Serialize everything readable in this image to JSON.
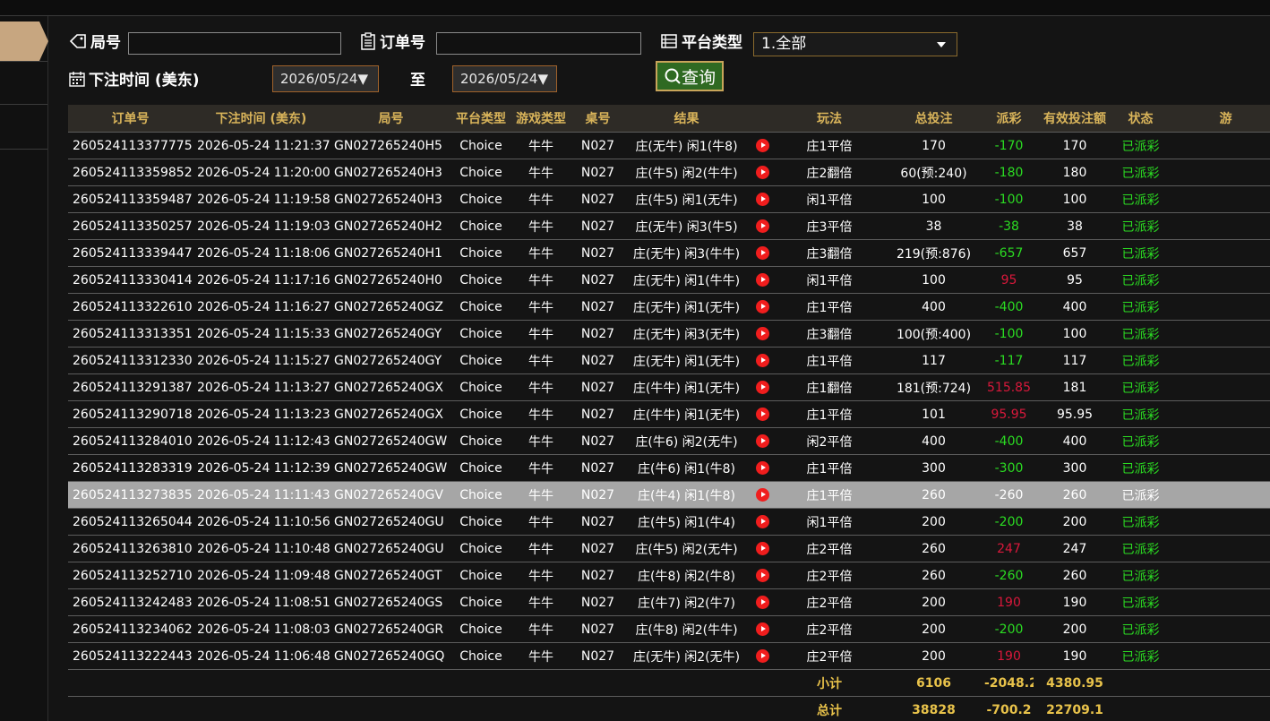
{
  "filters": {
    "round_label": "局号",
    "order_label": "订单号",
    "platform_label": "平台类型",
    "platform_value": "1.全部",
    "time_label": "下注时间 (美东)",
    "date_from": "2026/05/24▼",
    "to_label": "至",
    "date_to": "2026/05/24▼",
    "query_label": "查询"
  },
  "table": {
    "headers": [
      "订单号",
      "下注时间 (美东)",
      "局号",
      "平台类型",
      "游戏类型",
      "桌号",
      "结果",
      "",
      "玩法",
      "总投注",
      "派彩",
      "有效投注额",
      "状态",
      "游"
    ],
    "rows": [
      [
        "260524113377775",
        "2026-05-24 11:21:37",
        "GN027265240H5",
        "Choice",
        "牛牛",
        "N027",
        "庄(无牛) 闲1(牛8)",
        "庄1平倍",
        "170",
        "-170",
        "170",
        "已派彩"
      ],
      [
        "260524113359852",
        "2026-05-24 11:20:00",
        "GN027265240H3",
        "Choice",
        "牛牛",
        "N027",
        "庄(牛5) 闲2(牛牛)",
        "庄2翻倍",
        "60(预:240)",
        "-180",
        "180",
        "已派彩"
      ],
      [
        "260524113359487",
        "2026-05-24 11:19:58",
        "GN027265240H3",
        "Choice",
        "牛牛",
        "N027",
        "庄(牛5) 闲1(无牛)",
        "闲1平倍",
        "100",
        "-100",
        "100",
        "已派彩"
      ],
      [
        "260524113350257",
        "2026-05-24 11:19:03",
        "GN027265240H2",
        "Choice",
        "牛牛",
        "N027",
        "庄(无牛) 闲3(牛5)",
        "庄3平倍",
        "38",
        "-38",
        "38",
        "已派彩"
      ],
      [
        "260524113339447",
        "2026-05-24 11:18:06",
        "GN027265240H1",
        "Choice",
        "牛牛",
        "N027",
        "庄(无牛) 闲3(牛牛)",
        "庄3翻倍",
        "219(预:876)",
        "-657",
        "657",
        "已派彩"
      ],
      [
        "260524113330414",
        "2026-05-24 11:17:16",
        "GN027265240H0",
        "Choice",
        "牛牛",
        "N027",
        "庄(无牛) 闲1(牛牛)",
        "闲1平倍",
        "100",
        "95",
        "95",
        "已派彩"
      ],
      [
        "260524113322610",
        "2026-05-24 11:16:27",
        "GN027265240GZ",
        "Choice",
        "牛牛",
        "N027",
        "庄(无牛) 闲1(无牛)",
        "庄1平倍",
        "400",
        "-400",
        "400",
        "已派彩"
      ],
      [
        "260524113313351",
        "2026-05-24 11:15:33",
        "GN027265240GY",
        "Choice",
        "牛牛",
        "N027",
        "庄(无牛) 闲3(无牛)",
        "庄3翻倍",
        "100(预:400)",
        "-100",
        "100",
        "已派彩"
      ],
      [
        "260524113312330",
        "2026-05-24 11:15:27",
        "GN027265240GY",
        "Choice",
        "牛牛",
        "N027",
        "庄(无牛) 闲1(无牛)",
        "庄1平倍",
        "117",
        "-117",
        "117",
        "已派彩"
      ],
      [
        "260524113291387",
        "2026-05-24 11:13:27",
        "GN027265240GX",
        "Choice",
        "牛牛",
        "N027",
        "庄(牛牛) 闲1(无牛)",
        "庄1翻倍",
        "181(预:724)",
        "515.85",
        "181",
        "已派彩"
      ],
      [
        "260524113290718",
        "2026-05-24 11:13:23",
        "GN027265240GX",
        "Choice",
        "牛牛",
        "N027",
        "庄(牛牛) 闲1(无牛)",
        "庄1平倍",
        "101",
        "95.95",
        "95.95",
        "已派彩"
      ],
      [
        "260524113284010",
        "2026-05-24 11:12:43",
        "GN027265240GW",
        "Choice",
        "牛牛",
        "N027",
        "庄(牛6) 闲2(无牛)",
        "闲2平倍",
        "400",
        "-400",
        "400",
        "已派彩"
      ],
      [
        "260524113283319",
        "2026-05-24 11:12:39",
        "GN027265240GW",
        "Choice",
        "牛牛",
        "N027",
        "庄(牛6) 闲1(牛8)",
        "庄1平倍",
        "300",
        "-300",
        "300",
        "已派彩"
      ],
      [
        "260524113273835",
        "2026-05-24 11:11:43",
        "GN027265240GV",
        "Choice",
        "牛牛",
        "N027",
        "庄(牛4) 闲1(牛8)",
        "庄1平倍",
        "260",
        "-260",
        "260",
        "已派彩"
      ],
      [
        "260524113265044",
        "2026-05-24 11:10:56",
        "GN027265240GU",
        "Choice",
        "牛牛",
        "N027",
        "庄(牛5) 闲1(牛4)",
        "闲1平倍",
        "200",
        "-200",
        "200",
        "已派彩"
      ],
      [
        "260524113263810",
        "2026-05-24 11:10:48",
        "GN027265240GU",
        "Choice",
        "牛牛",
        "N027",
        "庄(牛5) 闲2(无牛)",
        "庄2平倍",
        "260",
        "247",
        "247",
        "已派彩"
      ],
      [
        "260524113252710",
        "2026-05-24 11:09:48",
        "GN027265240GT",
        "Choice",
        "牛牛",
        "N027",
        "庄(牛8) 闲2(牛8)",
        "庄2平倍",
        "260",
        "-260",
        "260",
        "已派彩"
      ],
      [
        "260524113242483",
        "2026-05-24 11:08:51",
        "GN027265240GS",
        "Choice",
        "牛牛",
        "N027",
        "庄(牛7) 闲2(牛7)",
        "庄2平倍",
        "200",
        "190",
        "190",
        "已派彩"
      ],
      [
        "260524113234062",
        "2026-05-24 11:08:03",
        "GN027265240GR",
        "Choice",
        "牛牛",
        "N027",
        "庄(牛8) 闲2(牛牛)",
        "庄2平倍",
        "200",
        "-200",
        "200",
        "已派彩"
      ],
      [
        "260524113222443",
        "2026-05-24 11:06:48",
        "GN027265240GQ",
        "Choice",
        "牛牛",
        "N027",
        "庄(无牛) 闲2(无牛)",
        "庄2平倍",
        "200",
        "190",
        "190",
        "已派彩"
      ]
    ],
    "highlighted_row": 13,
    "subtotal": {
      "label": "小计",
      "total": "6106",
      "payout": "-2048.2",
      "valid": "4380.95"
    },
    "grandtotal": {
      "label": "总计",
      "total": "38828",
      "payout": "-700.2",
      "valid": "22709.1"
    }
  },
  "colors": {
    "header_gold": "#d9b45a",
    "win_red": "#d9183b",
    "loss_green": "#2bdc22",
    "button_green": "#2f6a22"
  }
}
